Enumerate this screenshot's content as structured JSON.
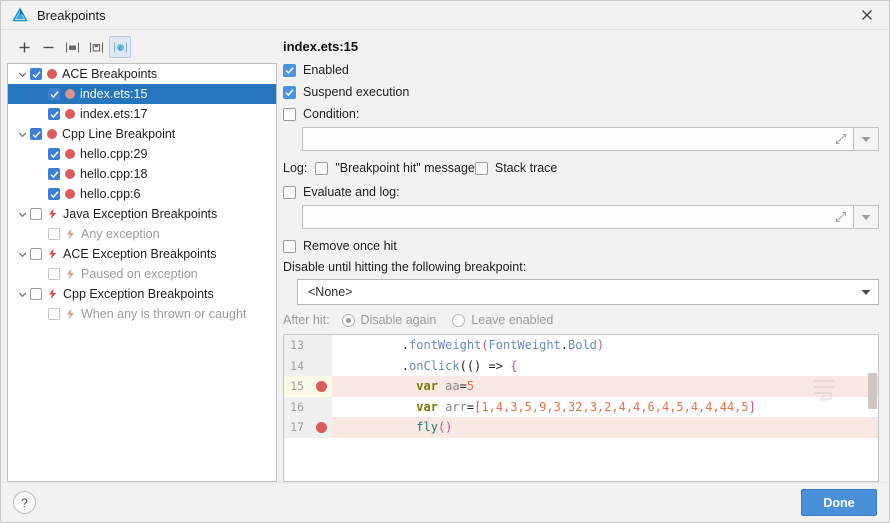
{
  "window": {
    "title": "Breakpoints",
    "logo_icon": "deveco-triangle-logo",
    "close_icon": "close-icon"
  },
  "toolbar": {
    "buttons": [
      {
        "name": "add-breakpoint-button",
        "icon": "plus-icon",
        "label": "+",
        "selected": false
      },
      {
        "name": "remove-breakpoint-button",
        "icon": "minus-icon",
        "label": "−",
        "selected": false
      },
      {
        "name": "group-breakpoints-button",
        "icon": "folder-icon",
        "label": "",
        "selected": false
      },
      {
        "name": "save-breakpoints-button",
        "icon": "save-icon",
        "label": "",
        "selected": false
      },
      {
        "name": "mute-breakpoints-button",
        "icon": "circle-c-icon",
        "label": "",
        "selected": true
      }
    ]
  },
  "tree": {
    "items": [
      {
        "label": "ACE Breakpoints",
        "indent": 0,
        "chevron": true,
        "checkbox": "checked",
        "icon": "breakpoint-dot-icon",
        "selected": false,
        "dim": false
      },
      {
        "label": "index.ets:15",
        "indent": 1,
        "chevron": false,
        "checkbox": "checked",
        "icon": "breakpoint-dot-icon",
        "selected": true,
        "dim": false
      },
      {
        "label": "index.ets:17",
        "indent": 1,
        "chevron": false,
        "checkbox": "checked",
        "icon": "breakpoint-dot-icon",
        "selected": false,
        "dim": false
      },
      {
        "label": "Cpp Line Breakpoint",
        "indent": 0,
        "chevron": true,
        "checkbox": "checked",
        "icon": "breakpoint-dot-icon",
        "selected": false,
        "dim": false
      },
      {
        "label": "hello.cpp:29",
        "indent": 1,
        "chevron": false,
        "checkbox": "checked",
        "icon": "breakpoint-dot-icon",
        "selected": false,
        "dim": false
      },
      {
        "label": "hello.cpp:18",
        "indent": 1,
        "chevron": false,
        "checkbox": "checked",
        "icon": "breakpoint-dot-icon",
        "selected": false,
        "dim": false
      },
      {
        "label": "hello.cpp:6",
        "indent": 1,
        "chevron": false,
        "checkbox": "checked",
        "icon": "breakpoint-dot-icon",
        "selected": false,
        "dim": false
      },
      {
        "label": "Java Exception Breakpoints",
        "indent": 0,
        "chevron": true,
        "checkbox": "unchecked",
        "icon": "exception-bolt-icon",
        "selected": false,
        "dim": false
      },
      {
        "label": "Any exception",
        "indent": 1,
        "chevron": false,
        "checkbox": "unchecked-dim",
        "icon": "exception-bolt-icon",
        "selected": false,
        "dim": true
      },
      {
        "label": "ACE Exception Breakpoints",
        "indent": 0,
        "chevron": true,
        "checkbox": "unchecked",
        "icon": "exception-bolt-icon",
        "selected": false,
        "dim": false
      },
      {
        "label": "Paused on exception",
        "indent": 1,
        "chevron": false,
        "checkbox": "unchecked-dim",
        "icon": "exception-bolt-icon",
        "selected": false,
        "dim": true
      },
      {
        "label": "Cpp Exception Breakpoints",
        "indent": 0,
        "chevron": true,
        "checkbox": "unchecked",
        "icon": "exception-bolt-icon",
        "selected": false,
        "dim": false
      },
      {
        "label": "When any is thrown or caught",
        "indent": 1,
        "chevron": false,
        "checkbox": "unchecked-dim",
        "icon": "exception-bolt-icon",
        "selected": false,
        "dim": true
      }
    ]
  },
  "details": {
    "breakpoint_title": "index.ets:15",
    "enabled_label": "Enabled",
    "enabled_checked": true,
    "suspend_label": "Suspend execution",
    "suspend_checked": true,
    "condition_label": "Condition:",
    "condition_checked": false,
    "condition_value": "",
    "condition_placeholder": "",
    "log_label": "Log:",
    "log_message_label": "\"Breakpoint hit\" message",
    "log_message_checked": false,
    "log_stack_label": "Stack trace",
    "log_stack_checked": false,
    "evaluate_label": "Evaluate and log:",
    "evaluate_checked": false,
    "evaluate_value": "",
    "evaluate_placeholder": "",
    "remove_once_hit_label": "Remove once hit",
    "remove_once_hit_checked": false,
    "disable_until_label": "Disable until hitting the following breakpoint:",
    "disable_until_value": "<None>",
    "after_hit_label": "After hit:",
    "after_hit_options": [
      {
        "label": "Disable again",
        "selected": true
      },
      {
        "label": "Leave enabled",
        "selected": false
      }
    ],
    "expand_icon": "expand-diagonal-icon",
    "dropdown_icon": "chevron-down-icon"
  },
  "code_preview": {
    "lines": [
      {
        "number": "13",
        "breakpoint": false,
        "current": false,
        "hit": false,
        "tokens": [
          {
            "t": ".",
            "c": "k-op"
          },
          {
            "t": "fontWeight",
            "c": "k-prop"
          },
          {
            "t": "(",
            "c": "k-brace"
          },
          {
            "t": "FontWeight",
            "c": "k-prop"
          },
          {
            "t": ".",
            "c": "k-op"
          },
          {
            "t": "Bold",
            "c": "k-prop"
          },
          {
            "t": ")",
            "c": "k-brace"
          }
        ],
        "indent": 8
      },
      {
        "number": "14",
        "breakpoint": false,
        "current": false,
        "hit": false,
        "tokens": [
          {
            "t": ".",
            "c": "k-op"
          },
          {
            "t": "onClick",
            "c": "k-prop"
          },
          {
            "t": "(()",
            "c": "k-op"
          },
          {
            "t": " => ",
            "c": "k-op"
          },
          {
            "t": "{",
            "c": "k-brace"
          }
        ],
        "indent": 8
      },
      {
        "number": "15",
        "breakpoint": true,
        "current": true,
        "hit": true,
        "tokens": [
          {
            "t": "var",
            "c": "k-kw2"
          },
          {
            "t": " ",
            "c": "k-op"
          },
          {
            "t": "aa",
            "c": "k-var"
          },
          {
            "t": "=",
            "c": "k-op"
          },
          {
            "t": "5",
            "c": "k-num"
          }
        ],
        "indent": 10
      },
      {
        "number": "16",
        "breakpoint": false,
        "current": false,
        "hit": false,
        "tokens": [
          {
            "t": "var",
            "c": "k-kw2"
          },
          {
            "t": " ",
            "c": "k-op"
          },
          {
            "t": "arr",
            "c": "k-var"
          },
          {
            "t": "=",
            "c": "k-op"
          },
          {
            "t": "[",
            "c": "k-brace"
          },
          {
            "t": "1,4,3,5,9,3,32,3,2,4,4,6,4,5,4,4,44,5",
            "c": "k-num"
          },
          {
            "t": "]",
            "c": "k-brace"
          }
        ],
        "indent": 10
      },
      {
        "number": "17",
        "breakpoint": true,
        "current": false,
        "hit": true,
        "tokens": [
          {
            "t": "fly",
            "c": "k-fn"
          },
          {
            "t": "()",
            "c": "k-brace"
          }
        ],
        "indent": 10
      }
    ],
    "code_text": {
      "line13": ".fontWeight(FontWeight.Bold)",
      "line14": ".onClick(() => {",
      "line15": "var aa=5",
      "line16": "var arr=[1,4,3,5,9,3,32,3,2,4,4,6,4,5,4,4,44,5]",
      "line17": "fly()"
    },
    "scrollbar_icon": "vertical-scrollbar-thumb",
    "watermark_icon": "soft-wrap-watermark-icon"
  },
  "footer": {
    "help_label": "?",
    "help_icon": "question-mark-icon",
    "done_label": "Done"
  },
  "colors": {
    "accent": "#4a90d9",
    "selection": "#2675bf",
    "breakpoint_red": "#db5c5c",
    "hit_line": "#fae8e4",
    "current_gutter": "#fbfbe8",
    "checkbox_blue": "#4a94de",
    "dialog_bg": "#f2f2f2"
  }
}
